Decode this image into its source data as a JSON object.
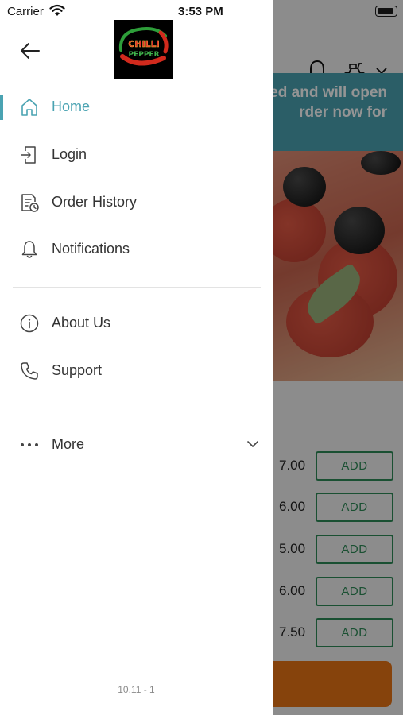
{
  "status_bar": {
    "carrier": "Carrier",
    "time": "3:53 PM"
  },
  "background": {
    "banner_line1": "ed and will open",
    "banner_line2": "rder now for",
    "items": [
      {
        "price": "7.00",
        "button": "ADD"
      },
      {
        "price": "6.00",
        "button": "ADD"
      },
      {
        "price": "5.00",
        "button": "ADD"
      },
      {
        "price": "6.00",
        "button": "ADD"
      },
      {
        "price": "7.50",
        "button": "ADD"
      }
    ]
  },
  "drawer": {
    "logo_text": [
      "CHILLI",
      "PEPPER"
    ],
    "menu": [
      {
        "label": "Home",
        "icon": "home-icon",
        "active": true
      },
      {
        "label": "Login",
        "icon": "login-icon",
        "active": false
      },
      {
        "label": "Order History",
        "icon": "order-history-icon",
        "active": false
      },
      {
        "label": "Notifications",
        "icon": "bell-icon",
        "active": false
      }
    ],
    "secondary_menu": [
      {
        "label": "About Us",
        "icon": "info-icon"
      },
      {
        "label": "Support",
        "icon": "phone-icon"
      }
    ],
    "more_label": "More",
    "version": "10.11 - 1"
  },
  "colors": {
    "accent": "#4aa3b2",
    "add_button": "#2e8b57",
    "cart_button": "#e77416"
  }
}
